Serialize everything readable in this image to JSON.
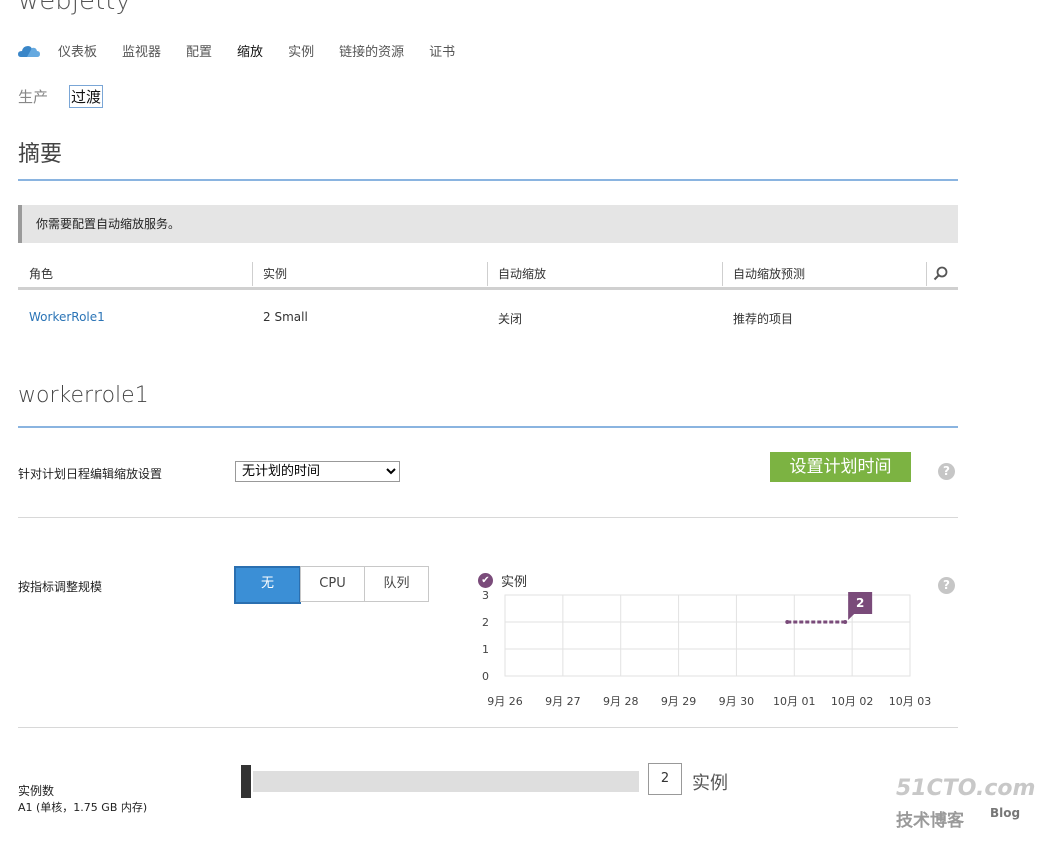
{
  "app": {
    "title": "webjetty"
  },
  "nav": {
    "items": [
      {
        "label": "仪表板"
      },
      {
        "label": "监视器"
      },
      {
        "label": "配置"
      },
      {
        "label": "缩放"
      },
      {
        "label": "实例"
      },
      {
        "label": "链接的资源"
      },
      {
        "label": "证书"
      }
    ],
    "active": "缩放"
  },
  "subnav": {
    "items": [
      {
        "label": "生产"
      },
      {
        "label": "过渡"
      }
    ],
    "active": "过渡"
  },
  "summary": {
    "heading": "摘要",
    "notice": "你需要配置自动缩放服务。",
    "columns": [
      "角色",
      "实例",
      "自动缩放",
      "自动缩放预测"
    ],
    "rows": [
      {
        "role": "WorkerRole1",
        "instances": "2 Small",
        "autoscale": "关闭",
        "prediction": "推荐的项目"
      }
    ]
  },
  "role_section": {
    "heading": "workerrole1",
    "schedule_label": "针对计划日程编辑缩放设置",
    "schedule_value": "无计划的时间",
    "set_schedule_button": "设置计划时间",
    "help_icon": "?",
    "metric_label": "按指标调整规模",
    "metric_options": [
      "无",
      "CPU",
      "队列"
    ],
    "metric_selected": "无",
    "instance_count_label": "实例数",
    "instance_size": "A1 (单核，1.75 GB 内存)",
    "instance_count": "2",
    "instance_unit": "实例",
    "slider_level": 0
  },
  "chart_data": {
    "type": "line",
    "series": [
      {
        "name": "实例",
        "x": [
          "10月 01",
          "10月 02"
        ],
        "values": [
          2,
          2
        ]
      }
    ],
    "x_ticks": [
      "9月 26",
      "9月 27",
      "9月 28",
      "9月 29",
      "9月 30",
      "10月 01",
      "10月 02",
      "10月 03"
    ],
    "y_ticks": [
      "0",
      "1",
      "2",
      "3"
    ],
    "ylim": [
      0,
      3
    ],
    "grid": true,
    "annotation": "2",
    "colors": {
      "series": "#7a4b7a",
      "grid": "#e2e2e2"
    }
  },
  "watermark": {
    "line1": "51CTO.com",
    "line2": "技术博客",
    "line3": "Blog"
  }
}
